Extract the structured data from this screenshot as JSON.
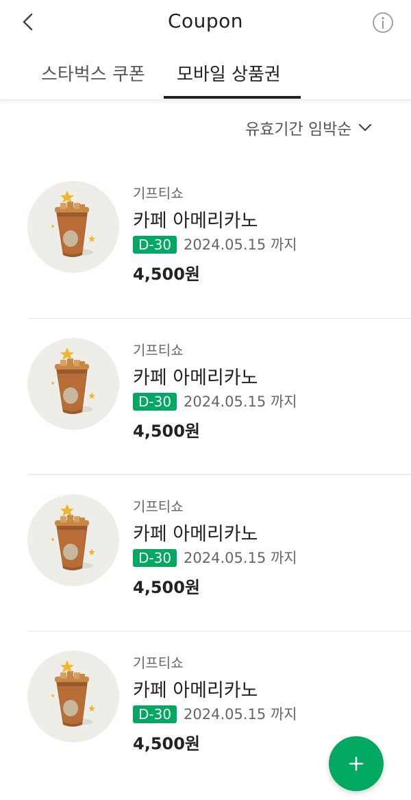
{
  "header": {
    "title": "Coupon",
    "back_icon": "chevron-left-icon",
    "info_icon": "info-icon"
  },
  "tabs": [
    {
      "label": "스타벅스 쿠폰",
      "active": false
    },
    {
      "label": "모바일 상품권",
      "active": true
    }
  ],
  "sort": {
    "label": "유효기간 임박순",
    "icon": "chevron-down-icon"
  },
  "items": [
    {
      "brand": "기프티쇼",
      "name": "카페 아메리카노",
      "dday": "D-30",
      "expire": "2024.05.15 까지",
      "price": "4,500원",
      "image": "iced-coffee-icon"
    },
    {
      "brand": "기프티쇼",
      "name": "카페 아메리카노",
      "dday": "D-30",
      "expire": "2024.05.15 까지",
      "price": "4,500원",
      "image": "iced-coffee-icon"
    },
    {
      "brand": "기프티쇼",
      "name": "카페 아메리카노",
      "dday": "D-30",
      "expire": "2024.05.15 까지",
      "price": "4,500원",
      "image": "iced-coffee-icon"
    },
    {
      "brand": "기프티쇼",
      "name": "카페 아메리카노",
      "dday": "D-30",
      "expire": "2024.05.15 까지",
      "price": "4,500원",
      "image": "iced-coffee-icon"
    }
  ],
  "fab": {
    "icon": "plus-icon"
  },
  "colors": {
    "accent": "#00a862",
    "text": "#222222",
    "muted": "#666666",
    "thumb_bg": "#efede8"
  }
}
